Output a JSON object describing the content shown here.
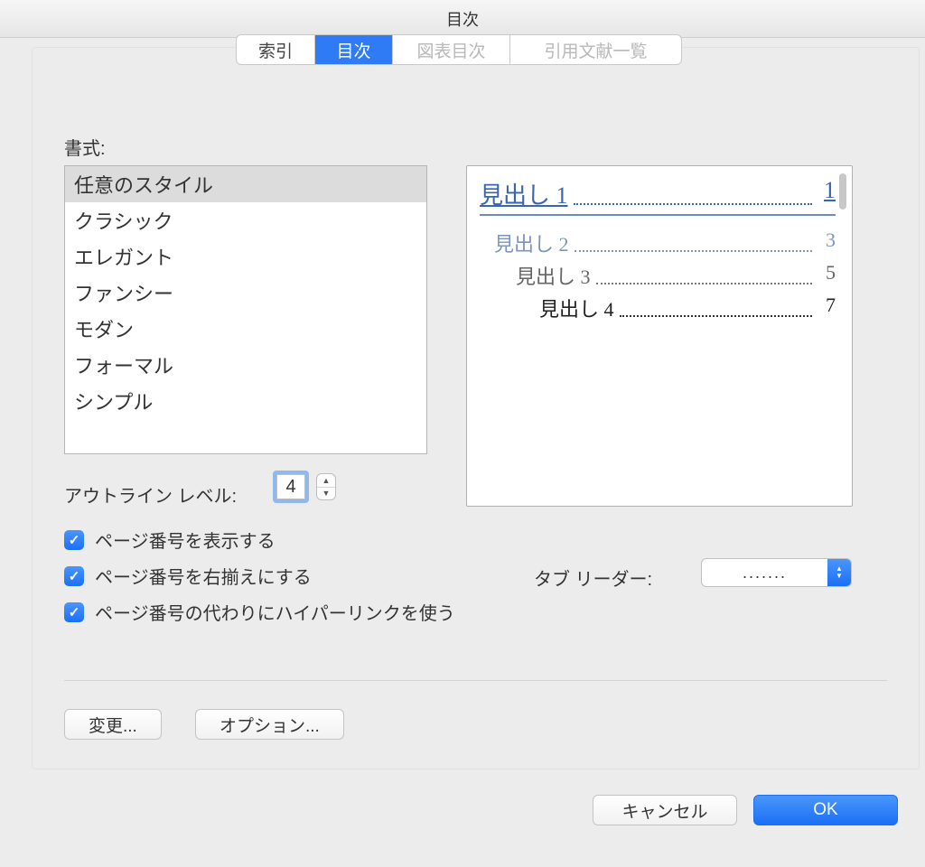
{
  "window": {
    "title": "目次"
  },
  "tabs": {
    "items": [
      "索引",
      "目次",
      "図表目次",
      "引用文献一覧"
    ],
    "active": 1
  },
  "format": {
    "label": "書式:",
    "items": [
      "任意のスタイル",
      "クラシック",
      "エレガント",
      "ファンシー",
      "モダン",
      "フォーマル",
      "シンプル"
    ],
    "selected": 0
  },
  "preview": {
    "entries": [
      {
        "label": "見出し 1",
        "page": "1"
      },
      {
        "label": "見出し 2",
        "page": "3"
      },
      {
        "label": "見出し 3",
        "page": "5"
      },
      {
        "label": "見出し 4",
        "page": "7"
      }
    ]
  },
  "outline": {
    "label": "アウトライン レベル:",
    "value": "4"
  },
  "checks": {
    "show_page": "ページ番号を表示する",
    "right_align": "ページ番号を右揃えにする",
    "hyperlinks": "ページ番号の代わりにハイパーリンクを使う"
  },
  "tab_leader": {
    "label": "タブ リーダー:",
    "value": "......."
  },
  "buttons": {
    "change": "変更...",
    "options": "オプション...",
    "cancel": "キャンセル",
    "ok": "OK"
  }
}
